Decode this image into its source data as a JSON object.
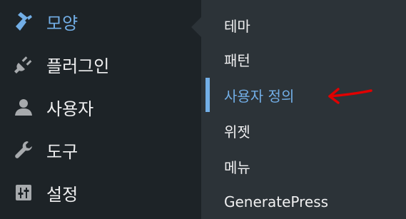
{
  "colors": {
    "sidebar_bg": "#1d2327",
    "submenu_bg": "#2c3338",
    "text": "#f0f0f1",
    "accent": "#72aee6",
    "icon": "#a7aaad",
    "annotation": "#e00000"
  },
  "sidebar": {
    "items": [
      {
        "label": "모양",
        "icon": "paintbrush-icon",
        "active": true
      },
      {
        "label": "플러그인",
        "icon": "plugin-plug-icon"
      },
      {
        "label": "사용자",
        "icon": "user-icon"
      },
      {
        "label": "도구",
        "icon": "wrench-icon"
      },
      {
        "label": "설정",
        "icon": "settings-sliders-icon"
      }
    ]
  },
  "submenu": {
    "items": [
      {
        "label": "테마"
      },
      {
        "label": "패턴"
      },
      {
        "label": "사용자 정의",
        "current": true
      },
      {
        "label": "위젯"
      },
      {
        "label": "메뉴"
      },
      {
        "label": "GeneratePress"
      }
    ]
  },
  "annotation": {
    "icon": "red-arrow-icon"
  }
}
